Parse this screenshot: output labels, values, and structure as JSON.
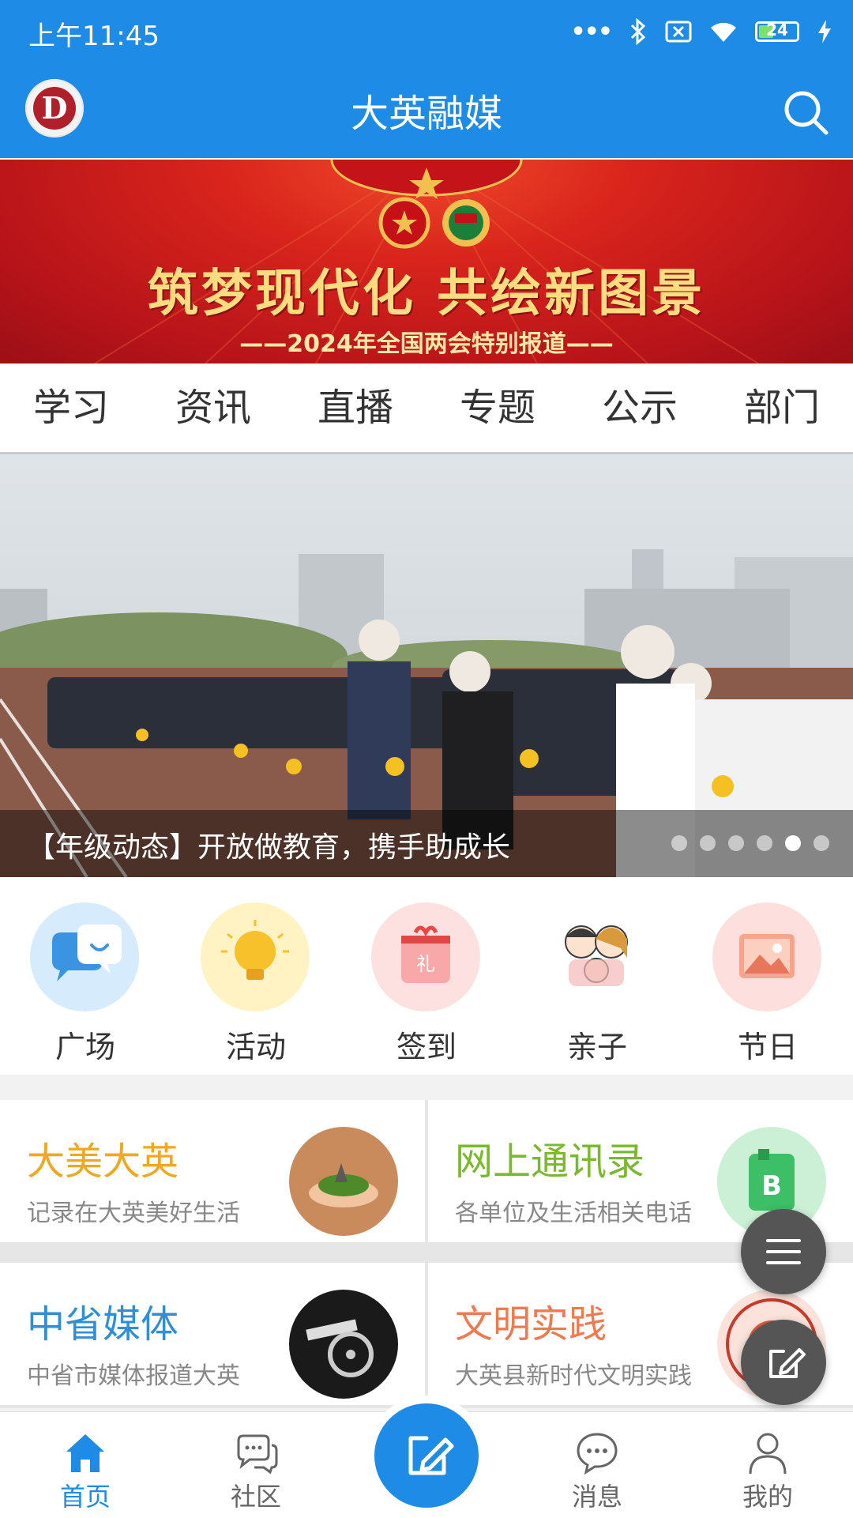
{
  "status_bar": {
    "time": "上午11:45",
    "battery": "24"
  },
  "header": {
    "title": "大英融媒"
  },
  "banner": {
    "title": "筑梦现代化 共绘新图景",
    "subtitle": "——2024年全国两会特别报道——"
  },
  "nav_tabs": [
    "学习",
    "资讯",
    "直播",
    "专题",
    "公示",
    "部门"
  ],
  "carousel": {
    "caption": "【年级动态】开放做教育，携手助成长",
    "active_index": 4,
    "count": 6
  },
  "quick_items": [
    {
      "label": "广场",
      "icon": "chat-bubbles-icon",
      "color": "#d8ecfb"
    },
    {
      "label": "活动",
      "icon": "lightbulb-icon",
      "color": "#fff3c4"
    },
    {
      "label": "签到",
      "icon": "gift-icon",
      "color": "#fde0e0"
    },
    {
      "label": "亲子",
      "icon": "family-icon",
      "color": "#ffffff"
    },
    {
      "label": "节日",
      "icon": "picture-icon",
      "color": "#fde0de"
    }
  ],
  "cards": [
    {
      "title": "大美大英",
      "desc": "记录在大英美好生活",
      "title_color": "#f0a81e"
    },
    {
      "title": "网上通讯录",
      "desc": "各单位及生活相关电话",
      "title_color": "#7ab82e"
    },
    {
      "title": "中省媒体",
      "desc": "中省市媒体报道大英",
      "title_color": "#2e8fd8"
    },
    {
      "title": "文明实践",
      "desc": "大英县新时代文明实践",
      "title_color": "#f07a50"
    }
  ],
  "bottom_nav": [
    {
      "label": "首页",
      "active": true
    },
    {
      "label": "社区",
      "active": false
    },
    {
      "label": "消息",
      "active": false
    },
    {
      "label": "我的",
      "active": false
    }
  ],
  "colors": {
    "primary": "#1e8ce6",
    "banner_red": "#d8241c"
  }
}
